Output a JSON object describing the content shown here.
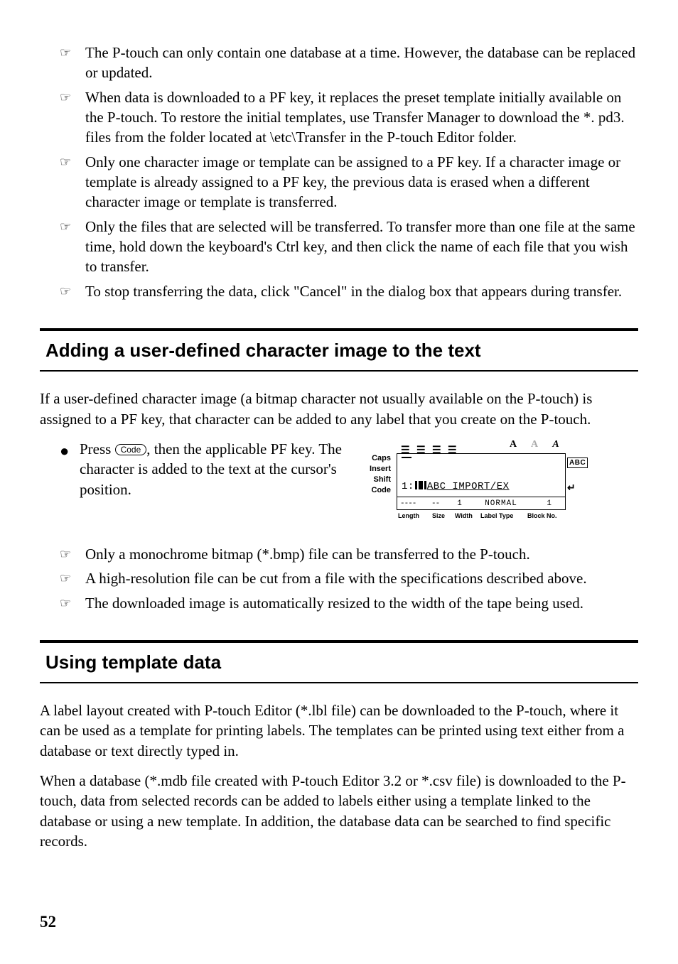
{
  "notes_top": [
    "The P-touch can only contain one database at a time. However, the database can be replaced or updated.",
    "When data is downloaded to a PF key, it replaces the preset template initially available on the P-touch. To restore the initial templates, use Transfer Manager to download the *. pd3. files from the folder located at \\etc\\Transfer in the P-touch Editor folder.",
    "Only one character image or template can be assigned to a PF key. If a character image or template is already assigned to a PF key, the previous data is erased when a different character image or template is transferred.",
    "Only the files that are selected will be transferred. To transfer more than one file at the same time, hold down the keyboard's Ctrl key, and then click the name of each file that you wish to transfer.",
    "To stop transferring the data, click \"Cancel\" in the dialog box that appears during transfer."
  ],
  "section1": {
    "title": "Adding a user-defined character image to the text",
    "intro": "If a user-defined character image (a bitmap character not usually available on the P-touch) is assigned to a PF key, that character can be added to any label that you create on the P-touch.",
    "step_prefix": "Press ",
    "step_key": "Code",
    "step_suffix": ", then the applicable PF key. The character is added to the text at the cursor's position."
  },
  "lcd": {
    "side": {
      "caps": "Caps",
      "insert": "Insert",
      "shift": "Shift",
      "code": "Code"
    },
    "line2_prefix": "1:",
    "line2_text": "ABC IMPORT/EX",
    "status": {
      "length": "----",
      "size": "--",
      "width": "1",
      "labeltype": "NORMAL",
      "block": "1"
    },
    "bottom": {
      "length": "Length",
      "size": "Size",
      "width": "Width",
      "labeltype": "Label Type",
      "block": "Block No."
    },
    "right_abc": "ABC"
  },
  "notes_mid": [
    "Only a monochrome bitmap (*.bmp) file can be transferred to the P-touch.",
    "A high-resolution file can be cut from a file with the specifications described above.",
    "The downloaded image is automatically resized to the width of the tape being used."
  ],
  "section2": {
    "title": "Using template data",
    "para1": "A label layout created with P-touch Editor (*.lbl file) can be downloaded to the P-touch, where it can be used as a template for printing labels. The templates can be printed using text either from a database or text directly typed in.",
    "para2": "When a database (*.mdb file created with P-touch Editor 3.2 or *.csv file) is downloaded to the P-touch, data from selected records can be added to labels either using a template linked to the database or using a new template. In addition, the database data can be searched to find specific records."
  },
  "page_num": "52"
}
